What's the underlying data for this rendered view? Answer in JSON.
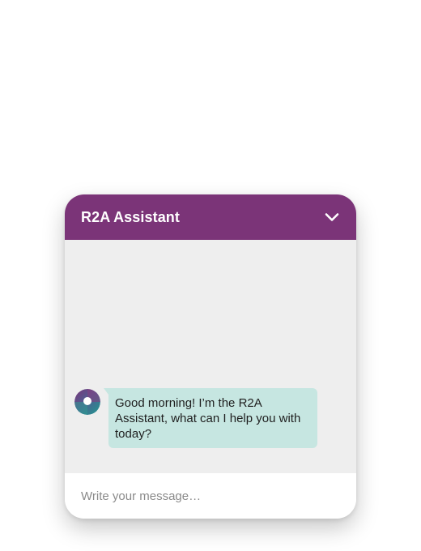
{
  "header": {
    "title": "R2A Assistant",
    "collapse_icon": "chevron-down-icon"
  },
  "messages": [
    {
      "sender": "assistant",
      "avatar_icon": "assistant-logo-icon",
      "text": "Good morning! I’m the R2A Assistant, what can I help you with today?"
    }
  ],
  "input": {
    "placeholder": "Write your message…",
    "value": ""
  },
  "colors": {
    "header_bg": "#7b3478",
    "body_bg": "#eeeeee",
    "bubble_bg": "#c6e6e1",
    "input_bg": "#ffffff"
  }
}
